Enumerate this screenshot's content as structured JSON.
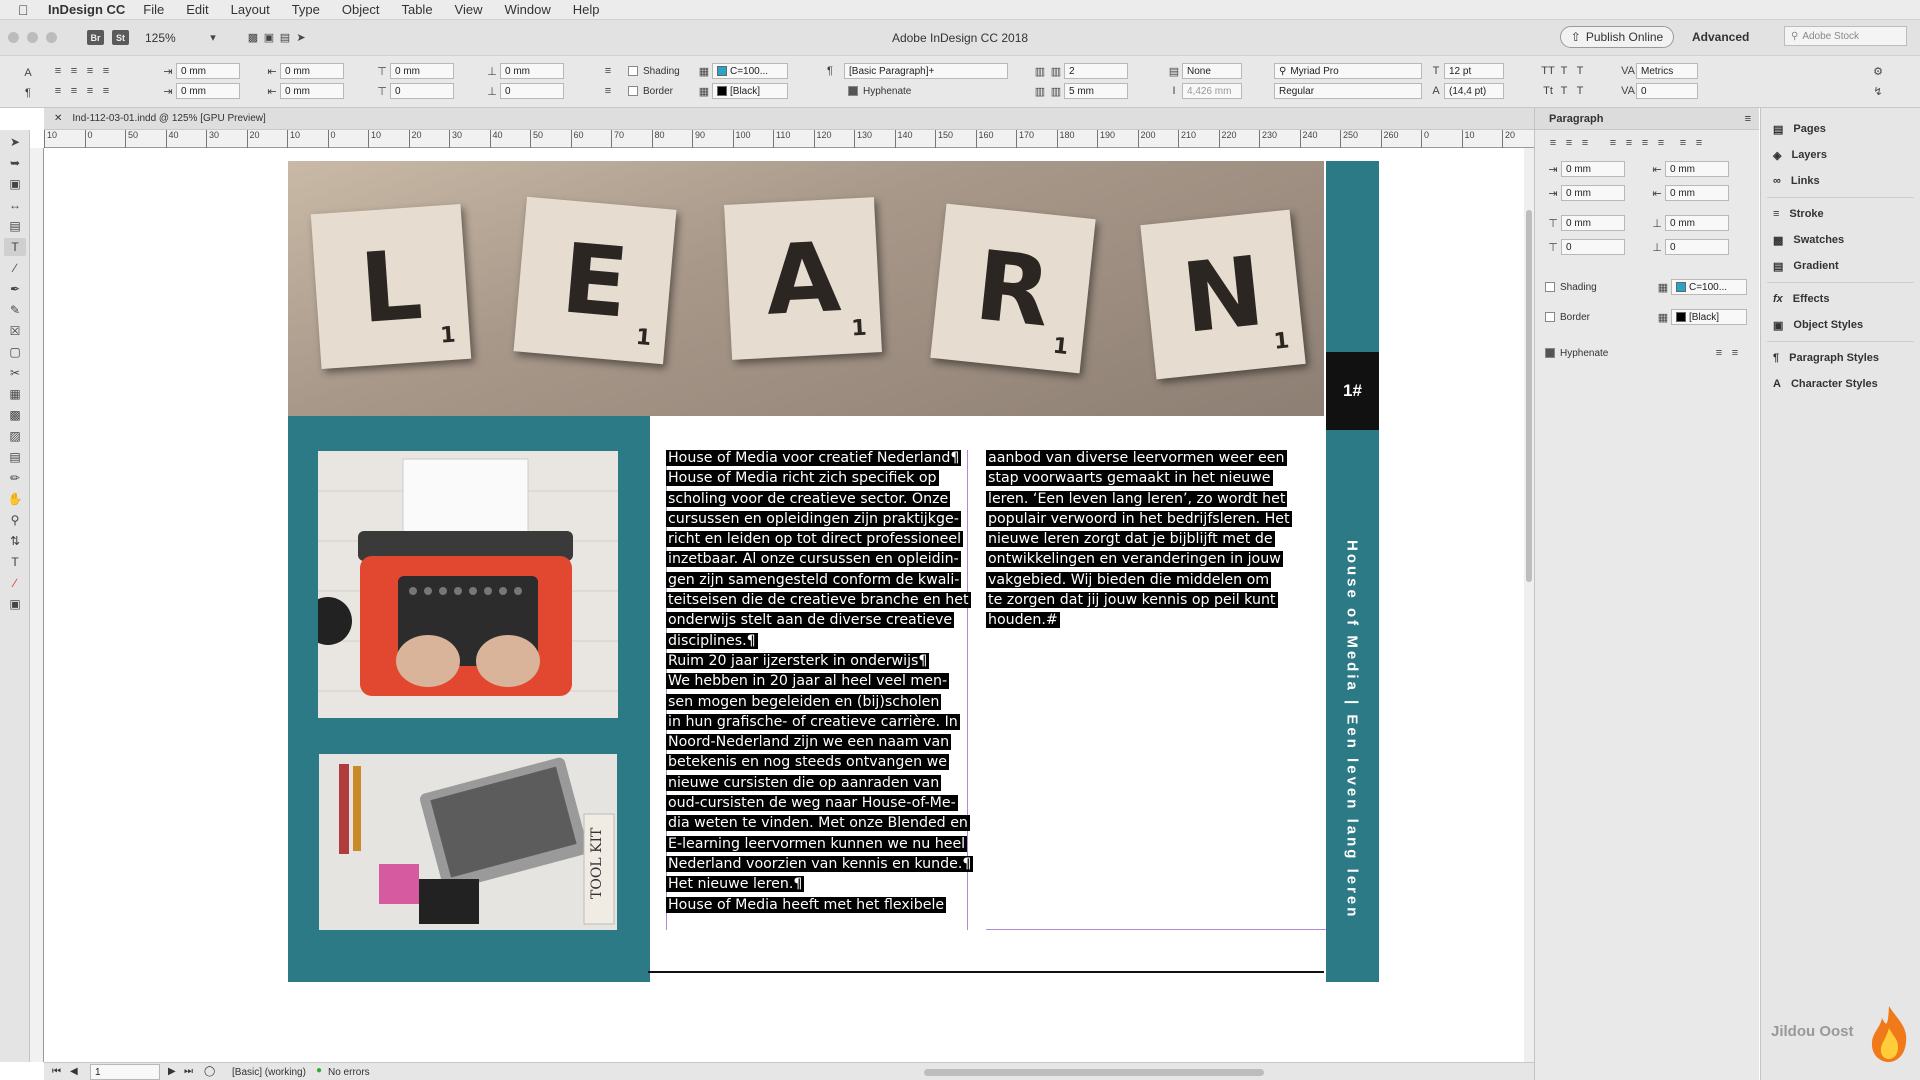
{
  "menubar": {
    "app": "InDesign CC",
    "items": [
      "File",
      "Edit",
      "Layout",
      "Type",
      "Object",
      "Table",
      "View",
      "Window",
      "Help"
    ]
  },
  "appbar": {
    "br": "Br",
    "st": "St",
    "zoom": "125%",
    "title": "Adobe InDesign CC 2018",
    "publish": "Publish Online",
    "workspace": "Advanced",
    "stock_placeholder": "Adobe Stock"
  },
  "control": {
    "indent_left": "0 mm",
    "indent_right": "0 mm",
    "indent_first": "0 mm",
    "indent_last": "0 mm",
    "space_before": "0 mm",
    "space_after": "0 mm",
    "dropcap_lines": "0",
    "dropcap_chars": "0",
    "shading": "Shading",
    "border": "Border",
    "shading_color": "C=100...",
    "border_color": "[Black]",
    "paragraph_style": "[Basic Paragraph]+",
    "hyphenate": "Hyphenate",
    "columns": "2",
    "gutter": "5 mm",
    "span": "None",
    "span_width": "4,426 mm",
    "font": "Myriad Pro",
    "font_style": "Regular",
    "font_size": "12 pt",
    "leading": "(14,4 pt)",
    "kerning": "Metrics",
    "tracking": "0"
  },
  "tab": {
    "label": "Ind-112-03-01.indd @ 125% [GPU Preview]"
  },
  "ruler": {
    "ticks": [
      "10",
      "0",
      "50",
      "40",
      "30",
      "20",
      "10",
      "0",
      "10",
      "20",
      "30",
      "40",
      "50",
      "60",
      "70",
      "80",
      "90",
      "100",
      "110",
      "120",
      "130",
      "140",
      "150",
      "160",
      "170",
      "180",
      "190",
      "200",
      "210",
      "220",
      "230",
      "240",
      "250",
      "260",
      "0",
      "10",
      "20",
      "30"
    ]
  },
  "document": {
    "hero_letters": [
      "L",
      "E",
      "A",
      "R",
      "N"
    ],
    "tile_sub": "1",
    "page_number": "1#",
    "vertical_text": "House of Media | Een leven lang leren",
    "img2_label": "TOOL KIT",
    "col1": [
      "House of Media voor creatief Nederland¶",
      "House of Media richt zich specifiek op",
      "scholing voor de creatieve sector. Onze",
      "cursussen en opleidingen zijn praktijkge-",
      "richt en leiden op tot direct professioneel",
      "inzetbaar. Al onze cursussen en opleidin-",
      "gen zijn samengesteld conform de kwali-",
      "teitseisen die de creatieve branche en het",
      "onderwijs stelt aan de diverse creatieve",
      "disciplines.¶",
      "Ruim 20 jaar ijzersterk in onderwijs¶",
      "We hebben in 20 jaar al heel veel men-",
      "sen mogen begeleiden en (bij)scholen",
      "in hun grafische- of creatieve carrière. In",
      "Noord-Nederland zijn we een naam van",
      "betekenis en nog steeds ontvangen we",
      "nieuwe cursisten die op aanraden van",
      "oud-cursisten de weg naar House-of-Me-",
      "dia weten te vinden. Met onze Blended en",
      "E-learning leervormen kunnen we nu heel",
      "Nederland voorzien van kennis en kunde.¶",
      "Het nieuwe leren.¶",
      "House of Media heeft met het flexibele"
    ],
    "col2": [
      "aanbod van diverse leervormen weer een",
      "stap voorwaarts gemaakt in het nieuwe",
      "leren. ‘Een leven lang leren’, zo wordt het",
      "populair verwoord in het bedrijfsleren. Het",
      "nieuwe leren zorgt dat je bijblijft met de",
      "ontwikkelingen en veranderingen in jouw",
      "vakgebied. Wij bieden die middelen om",
      "te zorgen dat jij jouw kennis op peil kunt",
      "houden.#"
    ]
  },
  "status": {
    "page": "1",
    "style": "[Basic] (working)",
    "errors": "No errors"
  },
  "panel": {
    "title": "Paragraph",
    "left_indent": "0 mm",
    "right_indent": "0 mm",
    "first_indent": "0 mm",
    "last_indent": "0 mm",
    "space_before": "0 mm",
    "space_after": "0 mm",
    "dropcap_lines": "0",
    "dropcap_chars": "0",
    "shading": "Shading",
    "shading_color": "C=100...",
    "border": "Border",
    "border_color": "[Black]",
    "hyphenate": "Hyphenate"
  },
  "dock": {
    "items": [
      "Pages",
      "Layers",
      "Links",
      "Stroke",
      "Swatches",
      "Gradient",
      "Effects",
      "Object Styles",
      "Paragraph Styles",
      "Character Styles"
    ]
  },
  "brand": "Jildou Oost",
  "colors": {
    "teal": "#2b7a86",
    "highlight": "#000000",
    "frame_guide": "#b08ad6"
  }
}
